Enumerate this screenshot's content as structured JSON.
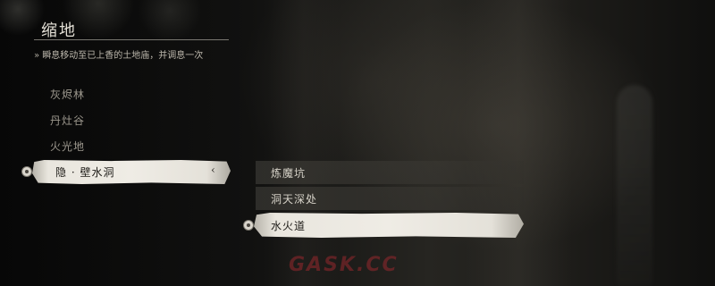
{
  "menu": {
    "title": "缩地",
    "subtitle": "» 瞬息移动至已上香的土地庙，并调息一次"
  },
  "regions": {
    "items": [
      "灰烬林",
      "丹灶谷",
      "火光地"
    ],
    "selected": "隐 · 壁水洞",
    "selected_chevron": "‹"
  },
  "sub_locations": {
    "items": [
      "炼魔坑",
      "洞天深处"
    ],
    "selected": "水火道"
  },
  "watermark": "GASK.CC",
  "colors": {
    "highlight": "#efece5",
    "selected_text": "#1d1b17",
    "watermark": "#96282d"
  }
}
